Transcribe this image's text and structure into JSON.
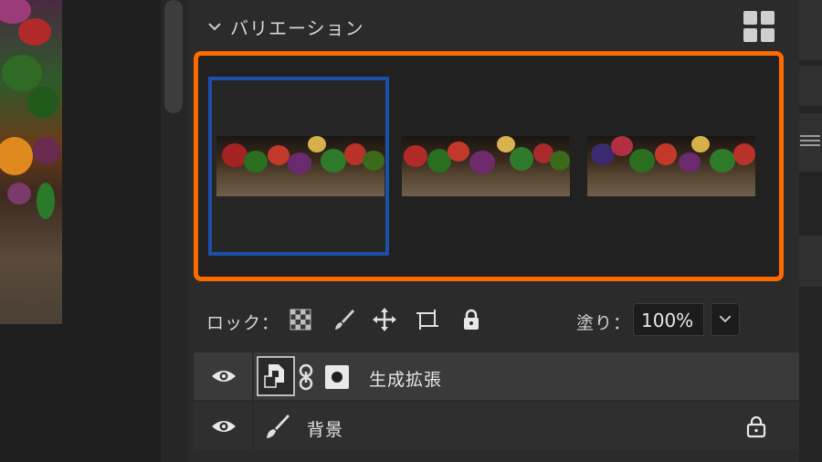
{
  "variations_panel": {
    "title": "バリエーション",
    "icons": {
      "collapse": "chevron-down-icon",
      "view": "grid-view-icon"
    },
    "variations": [
      {
        "label": "variation-1",
        "selected": true
      },
      {
        "label": "variation-2",
        "selected": false
      },
      {
        "label": "variation-3",
        "selected": false
      }
    ],
    "highlight_color": "#ff6a00",
    "selection_color": "#1c4fa8"
  },
  "layers_toolbar": {
    "lock_label": "ロック：",
    "lock_icons": [
      "lock-transparent-pixels-icon",
      "lock-image-pixels-icon",
      "lock-position-icon",
      "lock-artboard-icon",
      "lock-all-icon"
    ],
    "fill_label": "塗り：",
    "fill_value": "100%"
  },
  "layers": [
    {
      "name": "生成拡張",
      "visible": true,
      "type": "generative-smart-object",
      "has_mask": true
    },
    {
      "name": "背景",
      "visible": true,
      "type": "background",
      "locked": true
    }
  ]
}
